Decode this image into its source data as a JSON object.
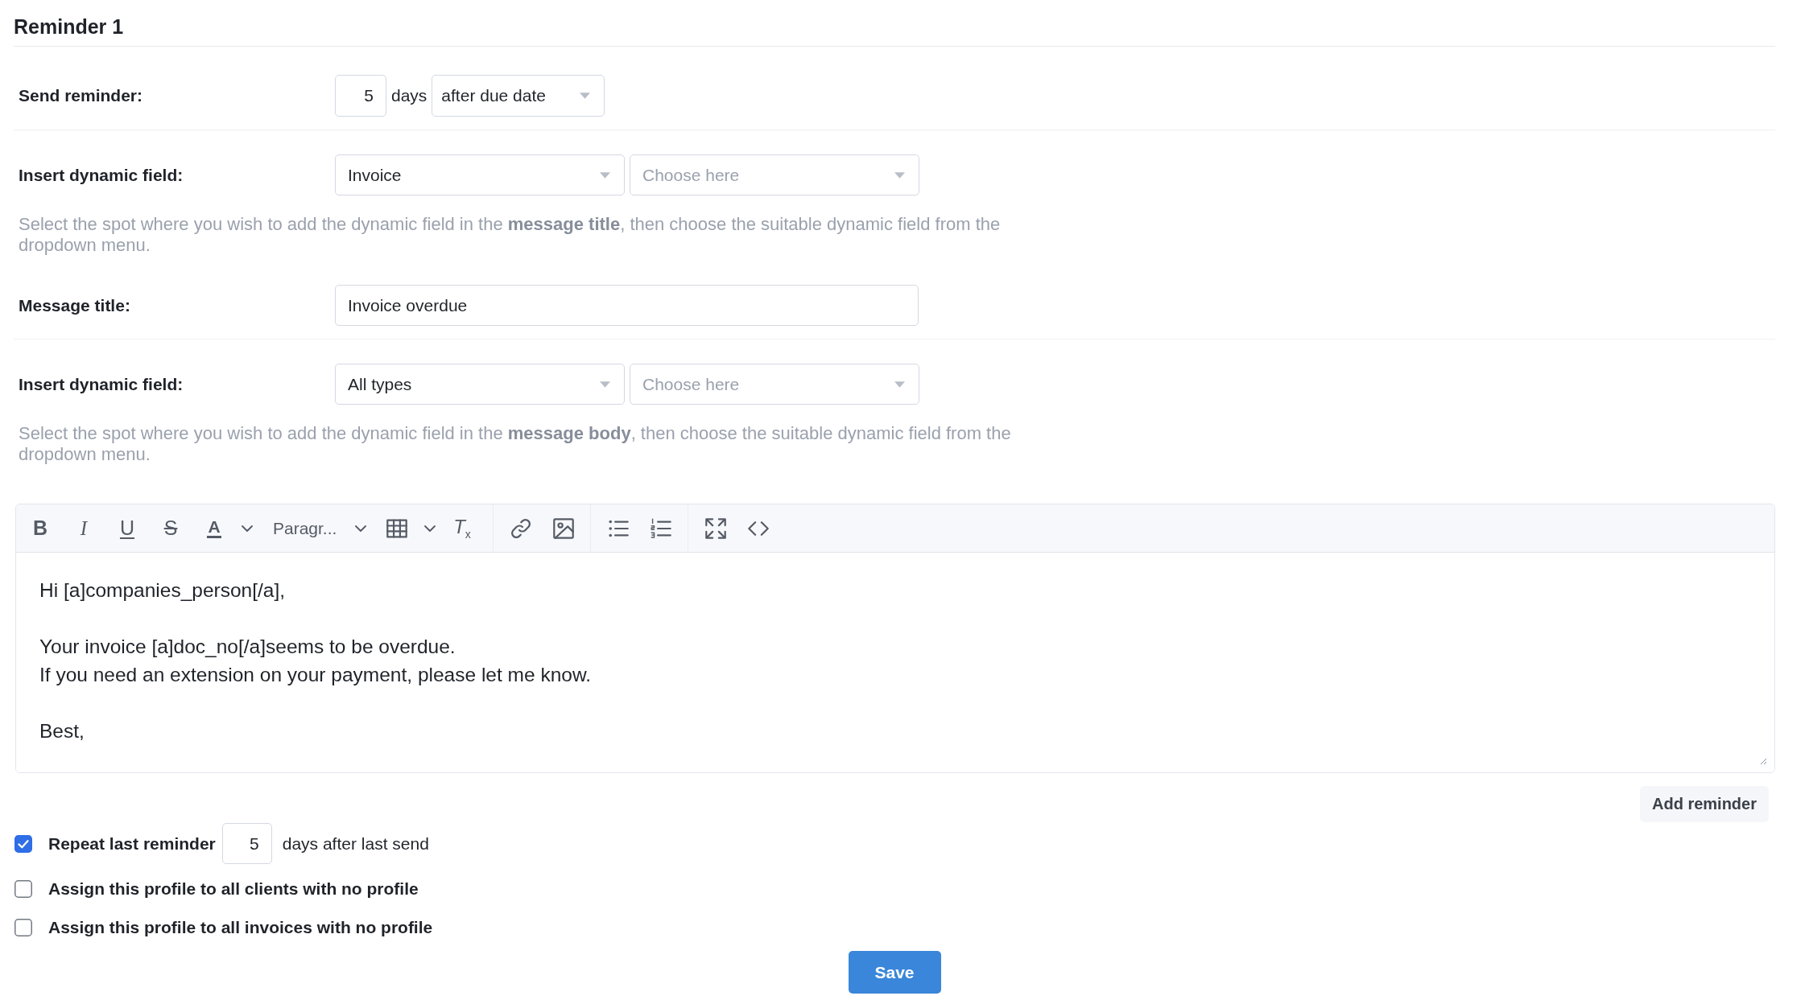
{
  "title": "Reminder 1",
  "rows": [
    {
      "kind": "send_timing",
      "label": "Send reminder:",
      "days": {
        "value": "5"
      },
      "unit": "days",
      "timing": {
        "value": "after due date"
      }
    },
    {
      "kind": "dynamic_field",
      "label": "Insert dynamic field:",
      "category": {
        "value": "Invoice"
      },
      "field": {
        "placeholder": "Choose here"
      },
      "help": "Select the spot where you wish to add the dynamic field in the **message title**, then choose the suitable dynamic field from the dropdown menu."
    },
    {
      "kind": "text_input",
      "label": "Message title:",
      "input": {
        "value": "Invoice overdue"
      }
    },
    {
      "kind": "dynamic_field",
      "label": "Insert dynamic field:",
      "category": {
        "value": "All types"
      },
      "field": {
        "placeholder": "Choose here"
      },
      "help": "Select the spot where you wish to add the dynamic field in the **message body**, then choose the suitable dynamic field from the dropdown menu."
    }
  ],
  "editor": {
    "toolbar_groups": [
      [
        {
          "kind": "bold",
          "glyph": "B"
        },
        {
          "kind": "italic",
          "glyph": "I"
        },
        {
          "kind": "underline",
          "glyph": "U"
        },
        {
          "kind": "strikethrough",
          "glyph": "S"
        },
        {
          "kind": "text_color",
          "glyph": "A"
        },
        {
          "kind": "block_format",
          "value": "Paragr..."
        },
        {
          "kind": "table"
        },
        {
          "kind": "clear_formatting",
          "glyph": "T$_{x}$"
        }
      ],
      [
        {
          "kind": "link"
        },
        {
          "kind": "image"
        }
      ],
      [
        {
          "kind": "bullet_list"
        },
        {
          "kind": "numbered_list"
        }
      ],
      [
        {
          "kind": "fullscreen"
        },
        {
          "kind": "source_code"
        }
      ]
    ],
    "paragraphs": [
      [
        "Hi [a]companies_person[/a],"
      ],
      [
        "Your invoice [a]doc_no[/a]seems to be overdue.",
        "If you need an extension on your payment, please let me know."
      ],
      [
        "Best,"
      ]
    ]
  },
  "add_reminder_button": {
    "label": "Add reminder"
  },
  "options": [
    {
      "kind": "repeat",
      "checked": true,
      "label": "Repeat last reminder",
      "days": {
        "value": "5"
      },
      "suffix": "days after last send"
    },
    {
      "kind": "plain",
      "checked": false,
      "label": "Assign this profile to all clients with no profile"
    },
    {
      "kind": "plain",
      "checked": false,
      "label": "Assign this profile to all invoices with no profile"
    }
  ],
  "save_button": {
    "label": "Save"
  }
}
